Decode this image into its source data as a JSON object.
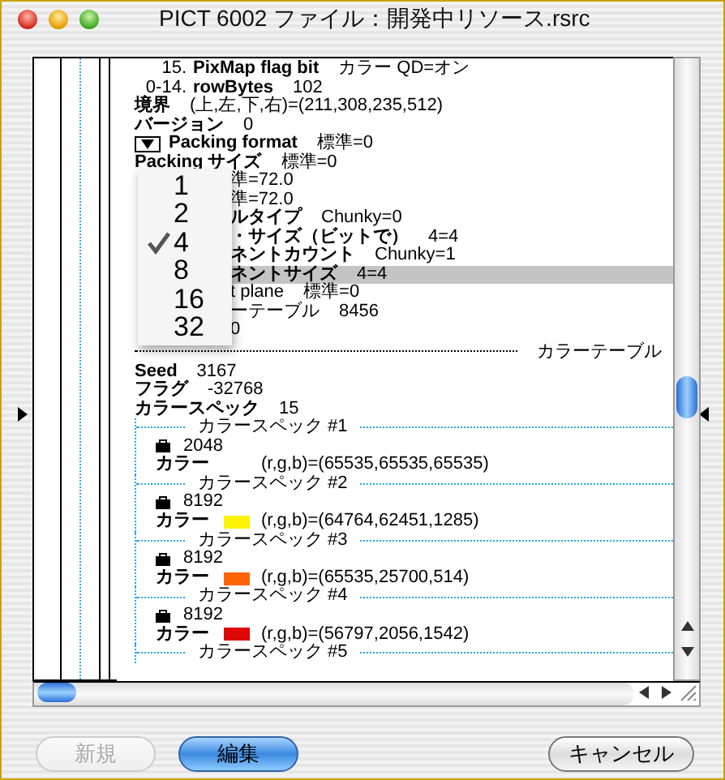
{
  "window": {
    "title": "PICT 6002  ファイル：開発中リソース.rsrc"
  },
  "rows": [
    {
      "kind": "bit",
      "prefix": "15.",
      "label": "PixMap flag bit",
      "value": "カラー QD=オン",
      "selected": false
    },
    {
      "kind": "bit",
      "prefix": "0-14.",
      "label": "rowBytes",
      "value": "102",
      "selected": false
    },
    {
      "kind": "field",
      "label": "境界",
      "value": "(上,左,下,右)=(211,308,235,512)",
      "selected": false
    },
    {
      "kind": "field",
      "label": "バージョン",
      "value": "0",
      "selected": false
    },
    {
      "kind": "popup",
      "label": "Packing format",
      "value": "標準=0",
      "selected": false
    },
    {
      "kind": "field",
      "label": "Packing サイズ",
      "value": "標準=0",
      "selected": false
    },
    {
      "kind": "covered",
      "value": "準=72.0",
      "selected": false
    },
    {
      "kind": "covered",
      "value": "準=72.0",
      "selected": false
    },
    {
      "kind": "covered",
      "label": "ルタイプ",
      "value": "Chunky=0",
      "selected": false
    },
    {
      "kind": "covered",
      "label": "・サイズ（ビットで）",
      "value": "4=4",
      "selected": false
    },
    {
      "kind": "covered",
      "label": "ネントカウント",
      "value": "Chunky=1",
      "selected": false
    },
    {
      "kind": "covered",
      "label": "ネントサイズ",
      "value": "4=4",
      "selected": true
    },
    {
      "kind": "covered",
      "plain": true,
      "label": "t plane",
      "value": "標準=0",
      "selected": false
    },
    {
      "kind": "covered",
      "plain": true,
      "label": "ーテーブル",
      "value": "8456",
      "selected": false
    },
    {
      "kind": "covered",
      "value": "0",
      "selected": false
    },
    {
      "kind": "separator",
      "label": "カラーテーブル",
      "selected": false
    },
    {
      "kind": "field",
      "label": "Seed",
      "value": "3167",
      "selected": false
    },
    {
      "kind": "field",
      "label": "フラグ",
      "value": "-32768",
      "selected": false
    },
    {
      "kind": "field",
      "label": "カラースペック",
      "value": "15",
      "selected": false
    }
  ],
  "color_specs": [
    {
      "title": "カラースペック #1",
      "value": "2048",
      "color_label": "カラー",
      "rgb": "(r,g,b)=(65535,65535,65535)"
    },
    {
      "title": "カラースペック #2",
      "value": "8192",
      "color_label": "カラー",
      "color": "#fcf302",
      "rgb": "(r,g,b)=(64764,62451,1285)"
    },
    {
      "title": "カラースペック #3",
      "value": "8192",
      "color_label": "カラー",
      "color": "#ff6402",
      "rgb": "(r,g,b)=(65535,25700,514)"
    },
    {
      "title": "カラースペック #4",
      "value": "8192",
      "color_label": "カラー",
      "color": "#dd0806",
      "rgb": "(r,g,b)=(56797,2056,1542)"
    },
    {
      "title": "カラースペック #5"
    }
  ],
  "popup_menu": [
    {
      "label": "1",
      "selected": false
    },
    {
      "label": "2",
      "selected": false
    },
    {
      "label": "4",
      "selected": true
    },
    {
      "label": "8",
      "selected": false
    },
    {
      "label": "16",
      "selected": false
    },
    {
      "label": "32",
      "selected": false
    }
  ],
  "buttons": [
    {
      "label": "新規",
      "kind": "normal",
      "disabled": true
    },
    {
      "label": "編集",
      "kind": "default",
      "disabled": false
    },
    {
      "label": "キャンセル",
      "kind": "normal",
      "disabled": false
    }
  ]
}
